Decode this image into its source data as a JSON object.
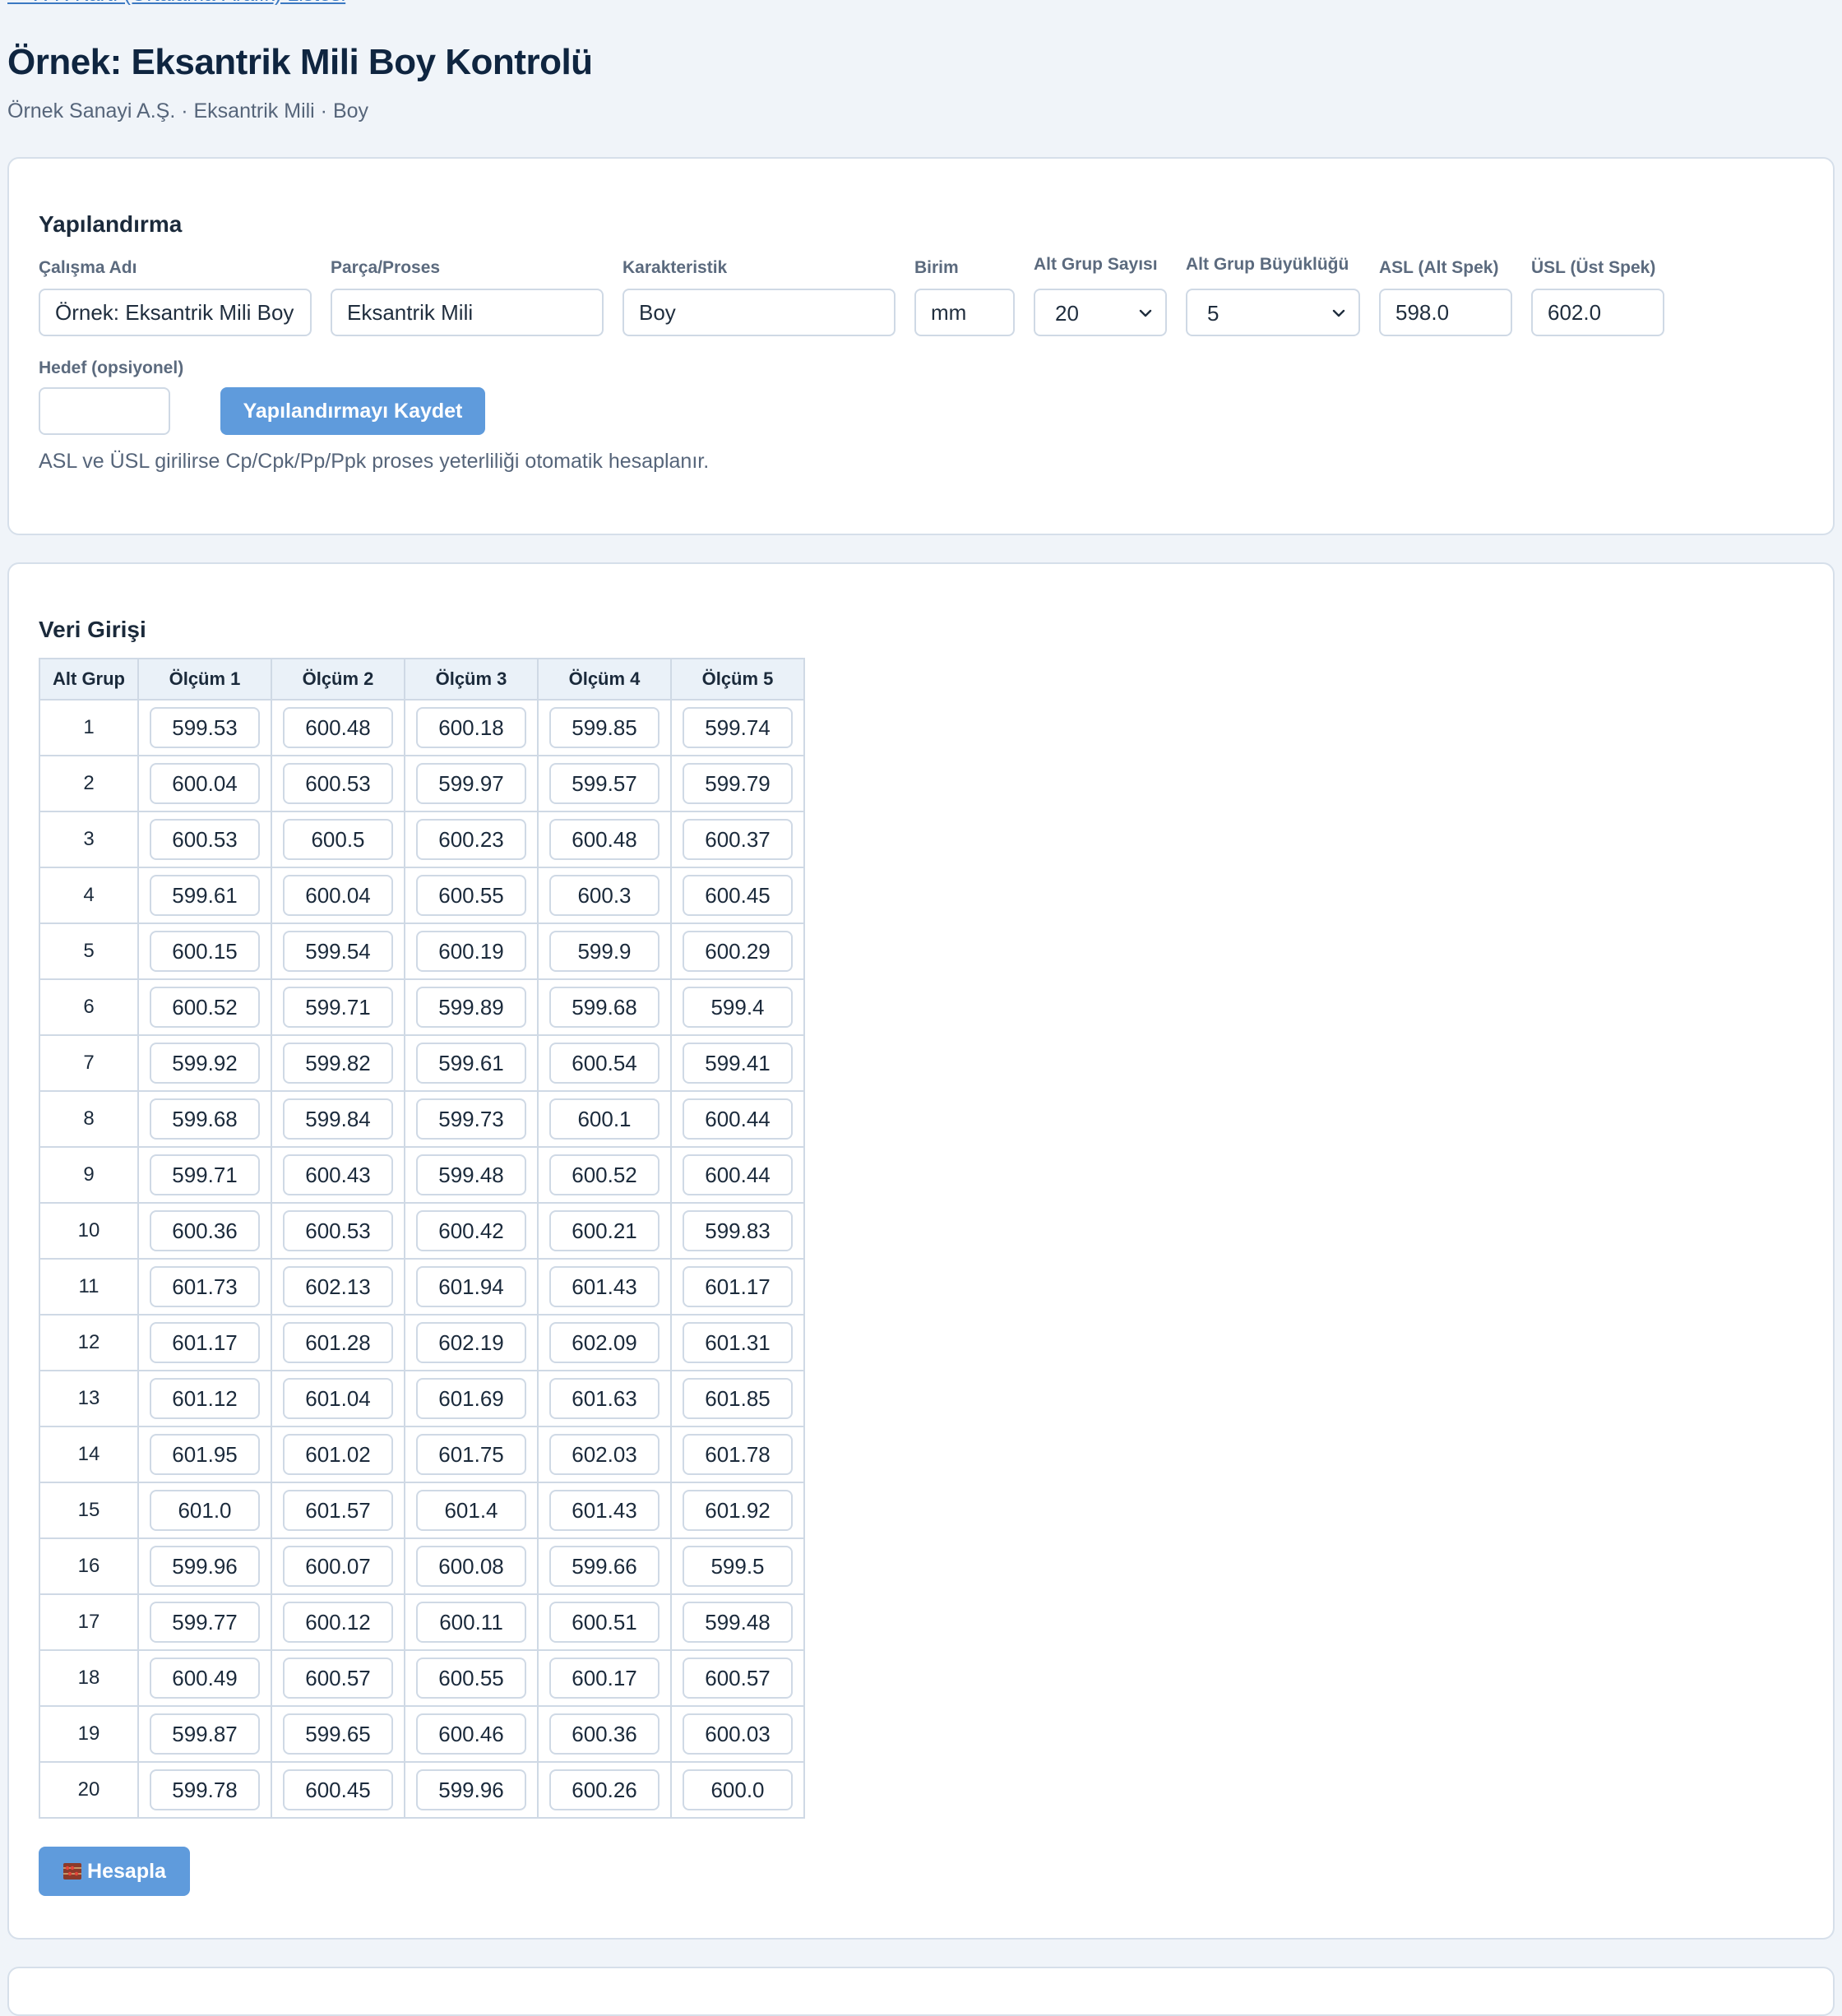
{
  "nav": {
    "back_link": "← X̄-R Kartı (Ortalama-Aralık) Listesi"
  },
  "header": {
    "title": "Örnek: Eksantrik Mili Boy Kontrolü",
    "subtitle": "Örnek Sanayi A.Ş. · Eksantrik Mili · Boy"
  },
  "config": {
    "title": "Yapılandırma",
    "fields": {
      "study_name": {
        "label": "Çalışma Adı",
        "value": "Örnek: Eksantrik Mili Boy Kontrolü"
      },
      "part": {
        "label": "Parça/Proses",
        "value": "Eksantrik Mili"
      },
      "characteristic": {
        "label": "Karakteristik",
        "value": "Boy"
      },
      "unit": {
        "label": "Birim",
        "value": "mm"
      },
      "subgroup_count": {
        "label": "Alt Grup Sayısı",
        "value": "20"
      },
      "subgroup_size": {
        "label": "Alt Grup Büyüklüğü",
        "value": "5"
      },
      "lsl": {
        "label": "ASL (Alt Spek)",
        "value": "598.0"
      },
      "usl": {
        "label": "ÜSL (Üst Spek)",
        "value": "602.0"
      },
      "target": {
        "label": "Hedef (opsiyonel)",
        "value": ""
      }
    },
    "save_button": "Yapılandırmayı Kaydet",
    "help": "ASL ve ÜSL girilirse Cp/Cpk/Pp/Ppk proses yeterliliği otomatik hesaplanır."
  },
  "data_entry": {
    "title": "Veri Girişi",
    "columns": [
      "Alt Grup",
      "Ölçüm 1",
      "Ölçüm 2",
      "Ölçüm 3",
      "Ölçüm 4",
      "Ölçüm 5"
    ],
    "rows": [
      [
        "1",
        "599.53",
        "600.48",
        "600.18",
        "599.85",
        "599.74"
      ],
      [
        "2",
        "600.04",
        "600.53",
        "599.97",
        "599.57",
        "599.79"
      ],
      [
        "3",
        "600.53",
        "600.5",
        "600.23",
        "600.48",
        "600.37"
      ],
      [
        "4",
        "599.61",
        "600.04",
        "600.55",
        "600.3",
        "600.45"
      ],
      [
        "5",
        "600.15",
        "599.54",
        "600.19",
        "599.9",
        "600.29"
      ],
      [
        "6",
        "600.52",
        "599.71",
        "599.89",
        "599.68",
        "599.4"
      ],
      [
        "7",
        "599.92",
        "599.82",
        "599.61",
        "600.54",
        "599.41"
      ],
      [
        "8",
        "599.68",
        "599.84",
        "599.73",
        "600.1",
        "600.44"
      ],
      [
        "9",
        "599.71",
        "600.43",
        "599.48",
        "600.52",
        "600.44"
      ],
      [
        "10",
        "600.36",
        "600.53",
        "600.42",
        "600.21",
        "599.83"
      ],
      [
        "11",
        "601.73",
        "602.13",
        "601.94",
        "601.43",
        "601.17"
      ],
      [
        "12",
        "601.17",
        "601.28",
        "602.19",
        "602.09",
        "601.31"
      ],
      [
        "13",
        "601.12",
        "601.04",
        "601.69",
        "601.63",
        "601.85"
      ],
      [
        "14",
        "601.95",
        "601.02",
        "601.75",
        "602.03",
        "601.78"
      ],
      [
        "15",
        "601.0",
        "601.57",
        "601.4",
        "601.43",
        "601.92"
      ],
      [
        "16",
        "599.96",
        "600.07",
        "600.08",
        "599.66",
        "599.5"
      ],
      [
        "17",
        "599.77",
        "600.12",
        "600.11",
        "600.51",
        "599.48"
      ],
      [
        "18",
        "600.49",
        "600.57",
        "600.55",
        "600.17",
        "600.57"
      ],
      [
        "19",
        "599.87",
        "599.65",
        "600.46",
        "600.36",
        "600.03"
      ],
      [
        "20",
        "599.78",
        "600.45",
        "599.96",
        "600.26",
        "600.0"
      ]
    ],
    "calculate_button": {
      "icon": "abacus-icon",
      "label": "Hesapla"
    }
  }
}
